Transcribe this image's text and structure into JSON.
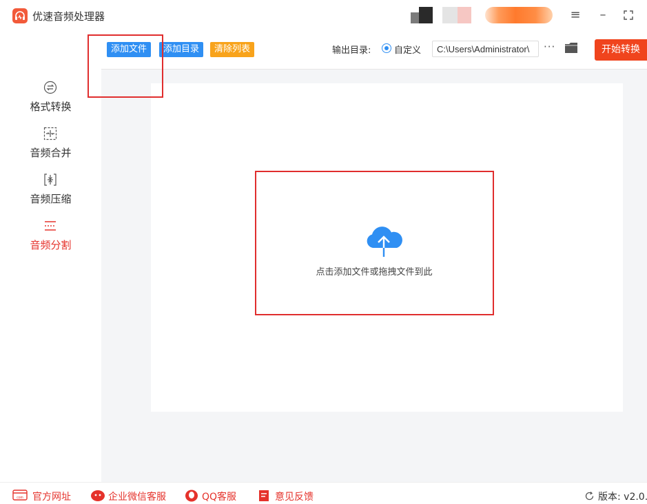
{
  "app": {
    "title": "优速音频处理器"
  },
  "sidebar": {
    "items": [
      {
        "label": "格式转换",
        "active": false
      },
      {
        "label": "音频合并",
        "active": false
      },
      {
        "label": "音频压缩",
        "active": false
      },
      {
        "label": "音频分割",
        "active": true
      }
    ]
  },
  "toolbar": {
    "add_file": "添加文件",
    "add_dir": "添加目录",
    "clear_list": "清除列表",
    "output_label": "输出目录:",
    "radio_label": "自定义",
    "output_path": "C:\\Users\\Administrator\\",
    "more": "···",
    "start": "开始转换"
  },
  "drop_zone": {
    "hint": "点击添加文件或拖拽文件到此"
  },
  "footer": {
    "website": "官方网址",
    "wechat": "企业微信客服",
    "qq": "QQ客服",
    "feedback": "意见反馈",
    "version": "版本: v2.0."
  },
  "colors": {
    "accent": "#2f8ff3",
    "danger": "#e5322b",
    "start": "#f0441d",
    "warning": "#f8a31b"
  }
}
